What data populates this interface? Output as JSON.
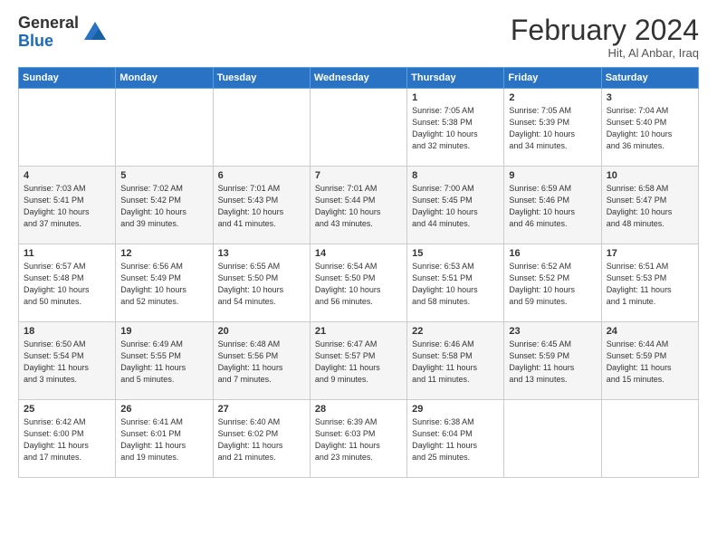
{
  "header": {
    "logo_general": "General",
    "logo_blue": "Blue",
    "month_title": "February 2024",
    "location": "Hit, Al Anbar, Iraq"
  },
  "weekdays": [
    "Sunday",
    "Monday",
    "Tuesday",
    "Wednesday",
    "Thursday",
    "Friday",
    "Saturday"
  ],
  "weeks": [
    [
      {
        "day": "",
        "info": ""
      },
      {
        "day": "",
        "info": ""
      },
      {
        "day": "",
        "info": ""
      },
      {
        "day": "",
        "info": ""
      },
      {
        "day": "1",
        "info": "Sunrise: 7:05 AM\nSunset: 5:38 PM\nDaylight: 10 hours\nand 32 minutes."
      },
      {
        "day": "2",
        "info": "Sunrise: 7:05 AM\nSunset: 5:39 PM\nDaylight: 10 hours\nand 34 minutes."
      },
      {
        "day": "3",
        "info": "Sunrise: 7:04 AM\nSunset: 5:40 PM\nDaylight: 10 hours\nand 36 minutes."
      }
    ],
    [
      {
        "day": "4",
        "info": "Sunrise: 7:03 AM\nSunset: 5:41 PM\nDaylight: 10 hours\nand 37 minutes."
      },
      {
        "day": "5",
        "info": "Sunrise: 7:02 AM\nSunset: 5:42 PM\nDaylight: 10 hours\nand 39 minutes."
      },
      {
        "day": "6",
        "info": "Sunrise: 7:01 AM\nSunset: 5:43 PM\nDaylight: 10 hours\nand 41 minutes."
      },
      {
        "day": "7",
        "info": "Sunrise: 7:01 AM\nSunset: 5:44 PM\nDaylight: 10 hours\nand 43 minutes."
      },
      {
        "day": "8",
        "info": "Sunrise: 7:00 AM\nSunset: 5:45 PM\nDaylight: 10 hours\nand 44 minutes."
      },
      {
        "day": "9",
        "info": "Sunrise: 6:59 AM\nSunset: 5:46 PM\nDaylight: 10 hours\nand 46 minutes."
      },
      {
        "day": "10",
        "info": "Sunrise: 6:58 AM\nSunset: 5:47 PM\nDaylight: 10 hours\nand 48 minutes."
      }
    ],
    [
      {
        "day": "11",
        "info": "Sunrise: 6:57 AM\nSunset: 5:48 PM\nDaylight: 10 hours\nand 50 minutes."
      },
      {
        "day": "12",
        "info": "Sunrise: 6:56 AM\nSunset: 5:49 PM\nDaylight: 10 hours\nand 52 minutes."
      },
      {
        "day": "13",
        "info": "Sunrise: 6:55 AM\nSunset: 5:50 PM\nDaylight: 10 hours\nand 54 minutes."
      },
      {
        "day": "14",
        "info": "Sunrise: 6:54 AM\nSunset: 5:50 PM\nDaylight: 10 hours\nand 56 minutes."
      },
      {
        "day": "15",
        "info": "Sunrise: 6:53 AM\nSunset: 5:51 PM\nDaylight: 10 hours\nand 58 minutes."
      },
      {
        "day": "16",
        "info": "Sunrise: 6:52 AM\nSunset: 5:52 PM\nDaylight: 10 hours\nand 59 minutes."
      },
      {
        "day": "17",
        "info": "Sunrise: 6:51 AM\nSunset: 5:53 PM\nDaylight: 11 hours\nand 1 minute."
      }
    ],
    [
      {
        "day": "18",
        "info": "Sunrise: 6:50 AM\nSunset: 5:54 PM\nDaylight: 11 hours\nand 3 minutes."
      },
      {
        "day": "19",
        "info": "Sunrise: 6:49 AM\nSunset: 5:55 PM\nDaylight: 11 hours\nand 5 minutes."
      },
      {
        "day": "20",
        "info": "Sunrise: 6:48 AM\nSunset: 5:56 PM\nDaylight: 11 hours\nand 7 minutes."
      },
      {
        "day": "21",
        "info": "Sunrise: 6:47 AM\nSunset: 5:57 PM\nDaylight: 11 hours\nand 9 minutes."
      },
      {
        "day": "22",
        "info": "Sunrise: 6:46 AM\nSunset: 5:58 PM\nDaylight: 11 hours\nand 11 minutes."
      },
      {
        "day": "23",
        "info": "Sunrise: 6:45 AM\nSunset: 5:59 PM\nDaylight: 11 hours\nand 13 minutes."
      },
      {
        "day": "24",
        "info": "Sunrise: 6:44 AM\nSunset: 5:59 PM\nDaylight: 11 hours\nand 15 minutes."
      }
    ],
    [
      {
        "day": "25",
        "info": "Sunrise: 6:42 AM\nSunset: 6:00 PM\nDaylight: 11 hours\nand 17 minutes."
      },
      {
        "day": "26",
        "info": "Sunrise: 6:41 AM\nSunset: 6:01 PM\nDaylight: 11 hours\nand 19 minutes."
      },
      {
        "day": "27",
        "info": "Sunrise: 6:40 AM\nSunset: 6:02 PM\nDaylight: 11 hours\nand 21 minutes."
      },
      {
        "day": "28",
        "info": "Sunrise: 6:39 AM\nSunset: 6:03 PM\nDaylight: 11 hours\nand 23 minutes."
      },
      {
        "day": "29",
        "info": "Sunrise: 6:38 AM\nSunset: 6:04 PM\nDaylight: 11 hours\nand 25 minutes."
      },
      {
        "day": "",
        "info": ""
      },
      {
        "day": "",
        "info": ""
      }
    ]
  ]
}
